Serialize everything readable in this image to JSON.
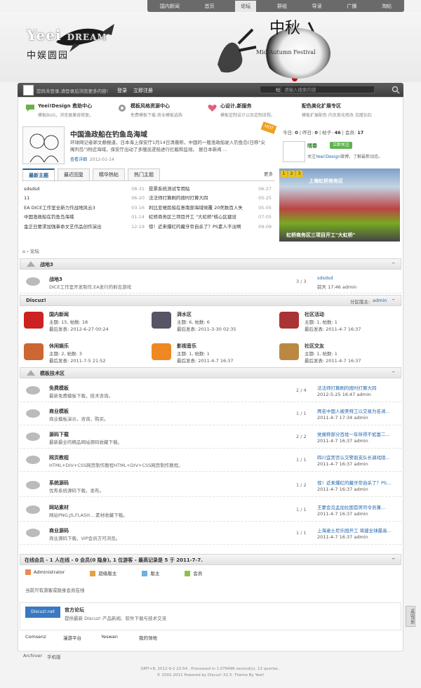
{
  "nav": {
    "items": [
      "国内新闻",
      "首页",
      "论坛",
      "群组",
      "导读",
      "广播",
      "淘帖"
    ],
    "active_index": 2
  },
  "banner": {
    "logo_main": "Yeei",
    "logo_dream": "DREAM",
    "logo_sub": "中娱圆园",
    "festival": "Mid-Autumn Festival",
    "festival_cn": "中秋"
  },
  "userbar": {
    "notice": "您尚未登录,请登录后浏览更多内容!",
    "login": "登录",
    "register": "立即注册",
    "select": "帖子",
    "search_placeholder": "请输入搜索内容"
  },
  "features": [
    {
      "title": "Yeei!Design 救助中心",
      "desc": "模板BUG，浏览器兼容修复。"
    },
    {
      "title": "模板风格资源中心",
      "desc": "免费模板下载  商业模板选购"
    },
    {
      "title": "心设计,新服务",
      "desc": "模板定制设计以及定制流程。"
    },
    {
      "title": "配色美化扩展专区",
      "desc": "模板扩展配色  内页美化修改  克隆钻石"
    }
  ],
  "headline": {
    "badge": "HOT",
    "title": "中国渔政船在钓鱼岛海域",
    "desc": "环球网记者郭文静报道，日本海上保安厅1月14日清晨称，中国的一艘渔政船驶入钓鱼岛(日称\"尖阁列岛\")附近海域，保安厅出动了多艘巡逻船进行拦截和监视。  据日本新闻 ...",
    "more": "查看详细",
    "date": "2012-01-14"
  },
  "stats": {
    "today_label": "今日:",
    "today": "0",
    "yesterday_label": "昨日:",
    "yesterday": "0",
    "posts_label": "帖子:",
    "posts": "46",
    "members_label": "会员:",
    "members": "17"
  },
  "weibo": {
    "name": "晴春",
    "follow": "立即关注",
    "desc_pre": "关注",
    "desc_brand": "Yeei!Design",
    "desc_post": "微博，了解最新动态。"
  },
  "tabs": [
    "最新主题",
    "最近回复",
    "精华热帖",
    "热门主题"
  ],
  "tab_more": "更多",
  "list_left": [
    {
      "t": "sdsdsd",
      "d": "08-31"
    },
    {
      "t": "11",
      "d": "06-20"
    },
    {
      "t": "EA DICE工作室全新力作战地风云3",
      "d": "03-16"
    },
    {
      "t": "中国渔政船在钓鱼岛海域",
      "d": "01-14"
    },
    {
      "t": "金正日要求加强革命文艺作品创作演出",
      "d": "12-19"
    }
  ],
  "list_right": [
    {
      "t": "投票系统测试专用贴",
      "d": "06-27"
    },
    {
      "t": "法法师打算刷的按时打算大四",
      "d": "05-25"
    },
    {
      "t": "利比亚难民船在意南部海域倾覆 20死数百人失",
      "d": "05-05"
    },
    {
      "t": "虹桥商务区三项目开工 \"大虹桥\"核心区建设",
      "d": "07-05"
    },
    {
      "t": "惊！近来爆红的藏牙帝自杀了？PS素人不淡啊",
      "d": "09-09"
    }
  ],
  "photo_caption": "虹桥商务区三项目开工\"大虹桥\"",
  "photo_banner_text": "上海虹桥商务区",
  "breadcrumb": "论坛",
  "sec1": {
    "title": "战地3",
    "row": {
      "name": "战地3",
      "desc": "DICE工作室开发制作,EA发行的射击游戏",
      "count": "3 / 3",
      "last_title": "sdsdsd",
      "last_meta": "前天 17:46 admin"
    }
  },
  "sec2": {
    "title": "Discuz!",
    "mod_label": "分区版主:",
    "mod": "admin",
    "forums": [
      {
        "name": "国内新闻",
        "l1": "主题: 15, 帖数: 18",
        "l2": "最后发表: 2012-6-27 00:24"
      },
      {
        "name": "湃水区",
        "l1": "主题: 6, 帖数: 6",
        "l2": "最后发表: 2011-3-30 02:35"
      },
      {
        "name": "社区活动",
        "l1": "主题: 1, 帖数: 1",
        "l2": "最后发表: 2011-4-7 16:37"
      },
      {
        "name": "休闲娱乐",
        "l1": "主题: 2, 帖数: 3",
        "l2": "最后发表: 2011-7-5 21:52"
      },
      {
        "name": "影视音乐",
        "l1": "主题: 1, 帖数: 1",
        "l2": "最后发表: 2011-4-7 16:37"
      },
      {
        "name": "社区交友",
        "l1": "主题: 1, 帖数: 1",
        "l2": "最后发表: 2011-4-7 16:37"
      }
    ]
  },
  "sec3": {
    "title": "模板技术区",
    "rows": [
      {
        "name": "免费模板",
        "desc": "最新免费模板下载，技术咨询。",
        "count": "2 / 4",
        "last_title": "法法师打算刷的按时打算大四",
        "last_meta": "2012-5-25 16:47 admin"
      },
      {
        "name": "商业模板",
        "desc": "商业模板演示，咨询，购买。",
        "count": "1 / 1",
        "last_title": "两名中国人被美特工以交易为名诱...",
        "last_meta": "2011-4-7 17:34 admin"
      },
      {
        "name": "源码下载",
        "desc": "最新最全的精品网站源码收藏下载。",
        "count": "2 / 2",
        "last_title": "党报称部分百姓一年所得不如富二...",
        "last_meta": "2011-4-7 16:37 admin"
      },
      {
        "name": "网页教程",
        "desc": "HTML+DIV+CSS网页制作教程HTML+DIV+CSS网页制作教程。",
        "count": "1 / 1",
        "last_title": "四川宜宾否认交警割支队长调戏阻...",
        "last_meta": "2011-4-7 16:37 admin"
      },
      {
        "name": "系统源码",
        "desc": "优秀系统源码下载，发布。",
        "count": "1 / 2",
        "last_title": "惊！近来爆红的藏牙帝自杀了？PS...",
        "last_meta": "2011-4-7 16:37 admin"
      },
      {
        "name": "网站素材",
        "desc": "网站PNG,JS,FLASH....素材收藏下载。",
        "count": "1 / 1",
        "last_title": "王蒙会见孟加拉国首席司令员兼...",
        "last_meta": "2011-4-7 16:37 admin"
      },
      {
        "name": "商业源码",
        "desc": "商业源码下载，VIP会员方可浏览。",
        "count": "1 / 1",
        "last_title": "上海逾士尼乐园开工 将建全球最高...",
        "last_meta": "2011-4-7 16:37 admin"
      }
    ]
  },
  "online": {
    "title": "在线会员 - 1 人在线 - 0 会员(0 隐身), 1 位游客 - 最高记录是 5 于 2011-7-7.",
    "legend": [
      "Administrator",
      "超级版主",
      "版主",
      "会员"
    ],
    "note": "当前只有游客或隐身会员在线"
  },
  "friendlink": {
    "logo": "Discuz!.net",
    "name": "官方论坛",
    "desc": "提供最新 Discuz! 产品新闻、软件下载与技术交流",
    "links": [
      "Comsenz",
      "漫游平台",
      "Yeswan",
      "我的领地"
    ]
  },
  "side_btn": "返回顶部",
  "footer": {
    "archiver": "Archiver",
    "mobile": "手机版",
    "line1": "GMT+8, 2012-9-2 22:54 , Processed in 1.079496 second(s), 13 queries .",
    "line2": "© 2001-2011 Powered by Discuz! X2.5. Theme By Yeei!"
  },
  "colors": {
    "accent": "#1f5e96",
    "topbar": "#4a4a4a",
    "hot": "#f0a020",
    "follow": "#5db34e"
  }
}
